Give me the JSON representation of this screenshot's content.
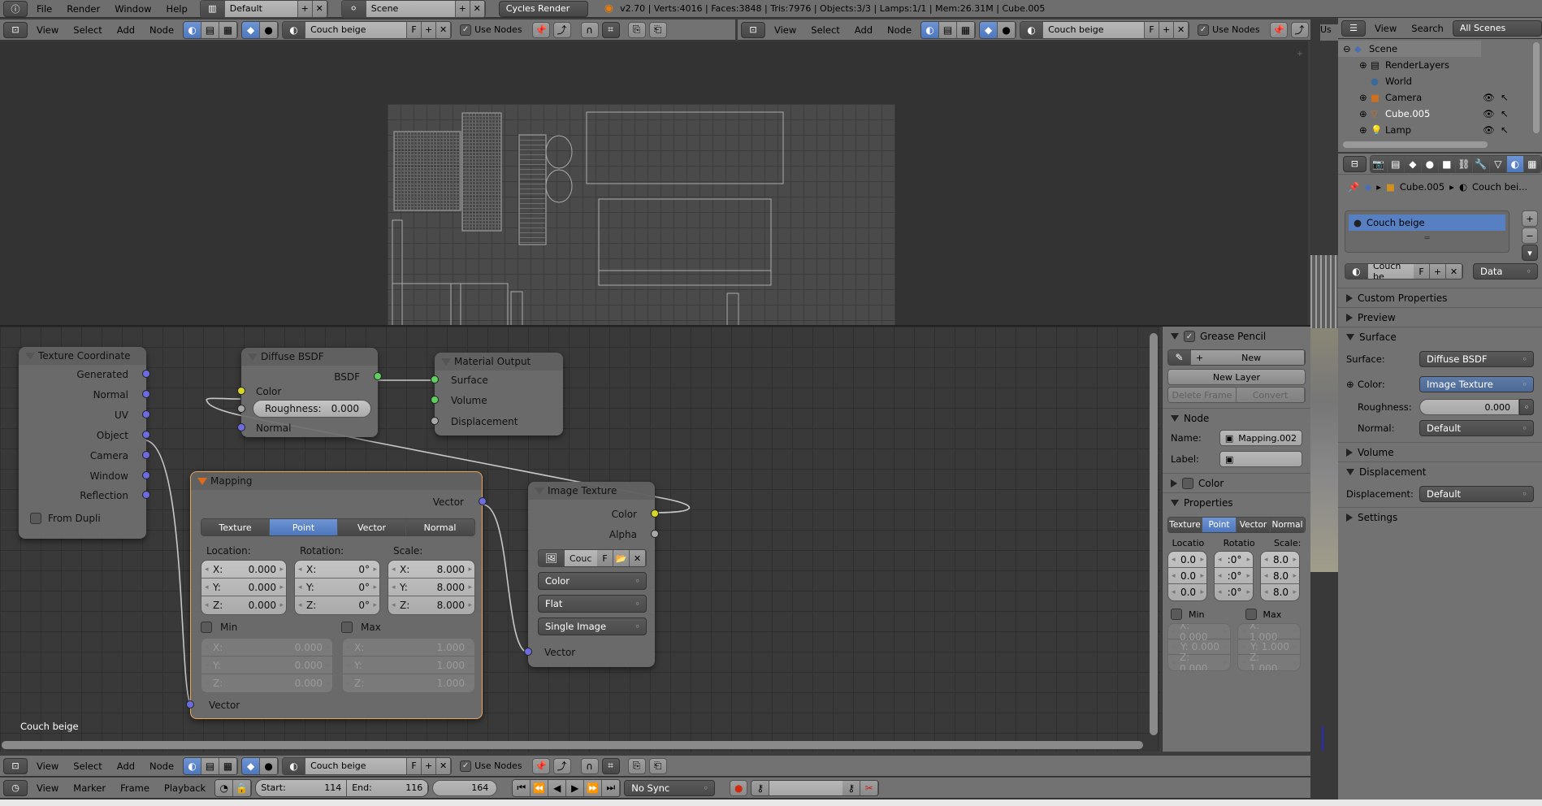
{
  "info_header": {
    "menus": [
      "File",
      "Render",
      "Window",
      "Help"
    ],
    "screen_layout": "Default",
    "scene": "Scene",
    "render_engine": "Cycles Render",
    "stats": "v2.70 | Verts:4016 | Faces:3848 | Tris:7976 | Objects:3/3 | Lamps:1/1 | Mem:26.31M | Cube.005"
  },
  "node_header": {
    "menus": [
      "View",
      "Select",
      "Add",
      "Node"
    ],
    "material": "Couch beige",
    "fake_user": "F",
    "use_nodes_label": "Use Nodes",
    "use_nodes_checked": true
  },
  "outliner": {
    "menus": [
      "View",
      "Search"
    ],
    "display_mode": "All Scenes",
    "items": [
      {
        "label": "Scene",
        "icon": "scene-icon"
      },
      {
        "label": "RenderLayers",
        "icon": "renderlayers-icon"
      },
      {
        "label": "World",
        "icon": "world-icon"
      },
      {
        "label": "Camera",
        "icon": "camera-icon"
      },
      {
        "label": "Cube.005",
        "icon": "mesh-icon"
      },
      {
        "label": "Lamp",
        "icon": "lamp-icon"
      }
    ]
  },
  "properties": {
    "breadcrumb": [
      "Cube.005",
      "Couch bei..."
    ],
    "material_slots": [
      "Couch beige"
    ],
    "material_name": "Couch be",
    "fake_user": "F",
    "link": "Data",
    "panels": {
      "custom_properties": "Custom Properties",
      "preview": "Preview",
      "surface": "Surface",
      "surface_label": "Surface:",
      "surface_value": "Diffuse BSDF",
      "color_label": "Color:",
      "color_value": "Image Texture",
      "roughness_label": "Roughness:",
      "roughness_value": "0.000",
      "normal_label": "Normal:",
      "normal_value": "Default",
      "volume": "Volume",
      "displacement": "Displacement",
      "displacement_label": "Displacement:",
      "displacement_value": "Default",
      "settings": "Settings"
    }
  },
  "sidebar": {
    "grease_pencil": "Grease Pencil",
    "new": "New",
    "new_layer": "New Layer",
    "delete_frame": "Delete Frame",
    "convert": "Convert",
    "node_panel": "Node",
    "name_label": "Name:",
    "name_value": "Mapping.002",
    "label_label": "Label:",
    "label_value": "",
    "color_panel": "Color",
    "properties_panel": "Properties",
    "tabs": [
      "Texture",
      "Point",
      "Vector",
      "Normal"
    ],
    "active_tab": "Point",
    "location": "Locatio",
    "rotation": "Rotatio",
    "scale": "Scale:",
    "loc_vals": [
      "0.0",
      "0.0",
      "0.0"
    ],
    "rot_vals": [
      ":0°",
      ":0°",
      ":0°"
    ],
    "scale_vals": [
      "8.0",
      "8.0",
      "8.0"
    ],
    "min": "Min",
    "max": "Max",
    "min_vals": [
      "X: 0.000",
      "Y: 0.000",
      "Z: 0.000"
    ],
    "max_vals": [
      "X: 1.000",
      "Y: 1.000",
      "Z: 1.000"
    ]
  },
  "nodes": {
    "texcoord": {
      "title": "Texture Coordinate",
      "outputs": [
        "Generated",
        "Normal",
        "UV",
        "Object",
        "Camera",
        "Window",
        "Reflection"
      ],
      "from_dupli": "From Dupli"
    },
    "diffuse": {
      "title": "Diffuse BSDF",
      "output": "BSDF",
      "color": "Color",
      "roughness_label": "Roughness:",
      "roughness_value": "0.000",
      "normal": "Normal"
    },
    "output": {
      "title": "Material Output",
      "inputs": [
        "Surface",
        "Volume",
        "Displacement"
      ]
    },
    "mapping": {
      "title": "Mapping",
      "output": "Vector",
      "tabs": [
        "Texture",
        "Point",
        "Vector",
        "Normal"
      ],
      "active_tab": "Point",
      "location": "Location:",
      "rotation": "Rotation:",
      "scale": "Scale:",
      "loc": [
        [
          "X:",
          "0.000"
        ],
        [
          "Y:",
          "0.000"
        ],
        [
          "Z:",
          "0.000"
        ]
      ],
      "rot": [
        [
          "X:",
          "0°"
        ],
        [
          "Y:",
          "0°"
        ],
        [
          "Z:",
          "0°"
        ]
      ],
      "scl": [
        [
          "X:",
          "8.000"
        ],
        [
          "Y:",
          "8.000"
        ],
        [
          "Z:",
          "8.000"
        ]
      ],
      "min": "Min",
      "max": "Max",
      "minv": [
        [
          "X:",
          "0.000"
        ],
        [
          "Y:",
          "0.000"
        ],
        [
          "Z:",
          "0.000"
        ]
      ],
      "maxv": [
        [
          "X:",
          "1.000"
        ],
        [
          "Y:",
          "1.000"
        ],
        [
          "Z:",
          "1.000"
        ]
      ],
      "input": "Vector"
    },
    "image": {
      "title": "Image Texture",
      "outputs": [
        "Color",
        "Alpha"
      ],
      "image_name": "Couc",
      "fake_user": "F",
      "color_space": "Color",
      "projection": "Flat",
      "source": "Single Image",
      "input": "Vector"
    }
  },
  "node_editor_label": "Couch beige",
  "timeline": {
    "menus": [
      "View",
      "Marker",
      "Frame",
      "Playback"
    ],
    "start_label": "Start:",
    "start": "114",
    "end_label": "End:",
    "end": "116",
    "current": "164",
    "sync": "No Sync"
  },
  "viewport_header_partial": "Us"
}
